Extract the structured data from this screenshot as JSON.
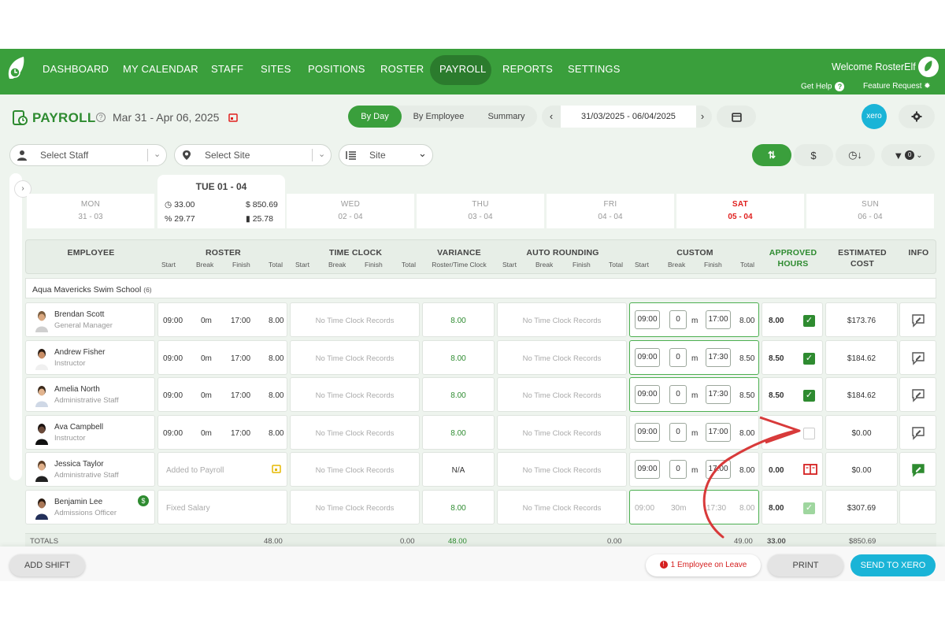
{
  "nav": {
    "items": [
      "DASHBOARD",
      "MY CALENDAR",
      "STAFF",
      "SITES",
      "POSITIONS",
      "ROSTER",
      "PAYROLL",
      "REPORTS",
      "SETTINGS"
    ],
    "active": "PAYROLL",
    "welcome": "Welcome RosterElf",
    "get_help": "Get Help",
    "feature_request": "Feature Request"
  },
  "header": {
    "title": "PAYROLL",
    "range": "Mar 31 - Apr 06, 2025",
    "view_tabs": [
      "By Day",
      "By Employee",
      "Summary"
    ],
    "active_view": "By Day",
    "date_range": "31/03/2025 - 06/04/2025",
    "xero_label": "xero"
  },
  "filters": {
    "staff_placeholder": "Select Staff",
    "site_placeholder": "Select Site",
    "group_by": "Site",
    "filter_count": "0"
  },
  "days": [
    {
      "name": "MON",
      "date": "31 - 03"
    },
    {
      "name": "TUE",
      "date": "01 - 04"
    },
    {
      "name": "WED",
      "date": "02 - 04"
    },
    {
      "name": "THU",
      "date": "03 - 04"
    },
    {
      "name": "FRI",
      "date": "04 - 04"
    },
    {
      "name": "SAT",
      "date": "05 - 04"
    },
    {
      "name": "SUN",
      "date": "06 - 04"
    }
  ],
  "active_day": {
    "label": "TUE 01 - 04",
    "hours": "33.00",
    "cost": "$ 850.69",
    "percent": "29.77",
    "avg": "25.78"
  },
  "columns": {
    "employee": "EMPLOYEE",
    "roster": "ROSTER",
    "time_clock": "TIME CLOCK",
    "variance": "VARIANCE",
    "variance_sub": "Roster/Time Clock",
    "auto_rounding": "AUTO ROUNDING",
    "custom": "CUSTOM",
    "approved": "APPROVED",
    "approved2": "HOURS",
    "estimated": "ESTIMATED",
    "estimated2": "COST",
    "info": "INFO",
    "start": "Start",
    "break": "Break",
    "finish": "Finish",
    "total": "Total"
  },
  "group": {
    "name": "Aqua Mavericks Swim School",
    "count": "(6)"
  },
  "no_records": "No Time Clock Records",
  "employees": [
    {
      "name": "Brendan Scott",
      "role": "General Manager",
      "r_start": "09:00",
      "r_break": "0m",
      "r_finish": "17:00",
      "r_total": "8.00",
      "variance": "8.00",
      "c_start": "09:00",
      "c_break": "0",
      "c_unit": "m",
      "c_finish": "17:00",
      "c_total": "8.00",
      "approved": "8.00",
      "cost": "$173.76"
    },
    {
      "name": "Andrew Fisher",
      "role": "Instructor",
      "r_start": "09:00",
      "r_break": "0m",
      "r_finish": "17:00",
      "r_total": "8.00",
      "variance": "8.00",
      "c_start": "09:00",
      "c_break": "0",
      "c_unit": "m",
      "c_finish": "17:30",
      "c_total": "8.50",
      "approved": "8.50",
      "cost": "$184.62"
    },
    {
      "name": "Amelia North",
      "role": "Administrative Staff",
      "r_start": "09:00",
      "r_break": "0m",
      "r_finish": "17:00",
      "r_total": "8.00",
      "variance": "8.00",
      "c_start": "09:00",
      "c_break": "0",
      "c_unit": "m",
      "c_finish": "17:30",
      "c_total": "8.50",
      "approved": "8.50",
      "cost": "$184.62"
    },
    {
      "name": "Ava Campbell",
      "role": "Instructor",
      "r_start": "09:00",
      "r_break": "0m",
      "r_finish": "17:00",
      "r_total": "8.00",
      "variance": "8.00",
      "c_start": "09:00",
      "c_break": "0",
      "c_unit": "m",
      "c_finish": "17:00",
      "c_total": "8.00",
      "approved": "",
      "cost": "$0.00"
    },
    {
      "name": "Jessica Taylor",
      "role": "Administrative Staff",
      "roster_note": "Added to Payroll",
      "variance": "N/A",
      "c_start": "09:00",
      "c_break": "0",
      "c_unit": "m",
      "c_finish": "17:00",
      "c_total": "8.00",
      "approved": "0.00",
      "cost": "$0.00"
    },
    {
      "name": "Benjamin Lee",
      "role": "Admissions Officer",
      "roster_note": "Fixed Salary",
      "variance": "8.00",
      "c_start": "09:00",
      "c_break": "30m",
      "c_finish": "17:30",
      "c_total": "8.00",
      "approved": "8.00",
      "cost": "$307.69",
      "salary_badge": "$"
    }
  ],
  "totals": {
    "label": "TOTALS",
    "roster": "48.00",
    "time_clock": "0.00",
    "variance": "48.00",
    "rounding": "0.00",
    "custom": "49.00",
    "approved": "33.00",
    "cost": "$850.69"
  },
  "bottom": {
    "add_shift": "ADD SHIFT",
    "leave": "1 Employee on Leave",
    "print": "PRINT",
    "send": "SEND TO XERO"
  },
  "colors": {
    "brand": "#3a9f3c",
    "brand_dark": "#2b7b2d",
    "xero": "#1ab4d7",
    "alert": "#d52020"
  }
}
